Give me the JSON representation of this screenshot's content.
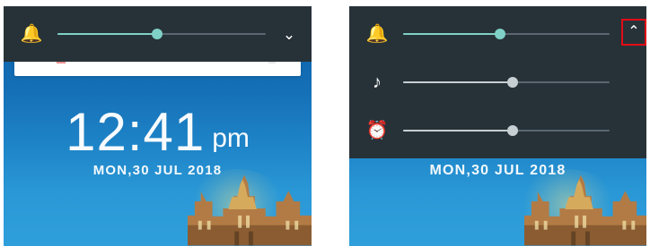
{
  "left_screen": {
    "volume_panel": {
      "ringer_icon": "bell-icon",
      "ringer_level": 0.48,
      "expand_icon": "chevron-down-icon"
    },
    "clock": {
      "time": "12:41",
      "ampm": "pm"
    },
    "date": "MON,30 JUL 2018"
  },
  "right_screen": {
    "volume_panel": {
      "rows": [
        {
          "icon": "bell-icon",
          "level": 0.47,
          "accent": "#7fd0c7"
        },
        {
          "icon": "music-note-icon",
          "level": 0.53,
          "accent": "#c7cfd3"
        },
        {
          "icon": "alarm-clock-icon",
          "level": 0.53,
          "accent": "#c7cfd3"
        }
      ],
      "collapse_icon": "chevron-up-icon"
    },
    "date": "MON,30 JUL 2018"
  },
  "colors": {
    "panel": "#273238",
    "slider_track": "#5a6770",
    "active_slider": "#7fd0c7",
    "inactive_slider": "#c7cfd3",
    "highlight": "#e30b17",
    "wallpaper_sky": "#1670b7"
  }
}
